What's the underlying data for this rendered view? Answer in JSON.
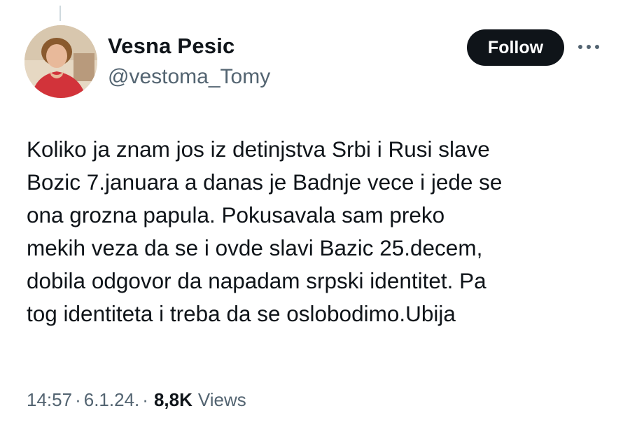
{
  "author": {
    "name": "Vesna Pesic",
    "handle": "@vestoma_Tomy"
  },
  "actions": {
    "follow_label": "Follow",
    "more_icon": "more-horizontal-icon"
  },
  "tweet": {
    "lines": [
      "Koliko ja znam jos iz detinjstva Srbi i Rusi slave",
      "Bozic 7.januara a danas je Badnje vece i jede se",
      "ona grozna papula. Pokusavala sam preko",
      "mekih veza da se i ovde slavi Bazic 25.decem,",
      "dobila odgovor da napadam srpski identitet. Pa",
      "tog identiteta i treba da se oslobodimo.Ubija"
    ]
  },
  "meta": {
    "time": "14:57",
    "separator": "·",
    "date": "6.1.24.",
    "views_count": "8,8K",
    "views_label": "Views"
  },
  "colors": {
    "text_primary": "#0f1419",
    "text_secondary": "#536471",
    "button_bg": "#0f1419",
    "button_text": "#ffffff"
  }
}
